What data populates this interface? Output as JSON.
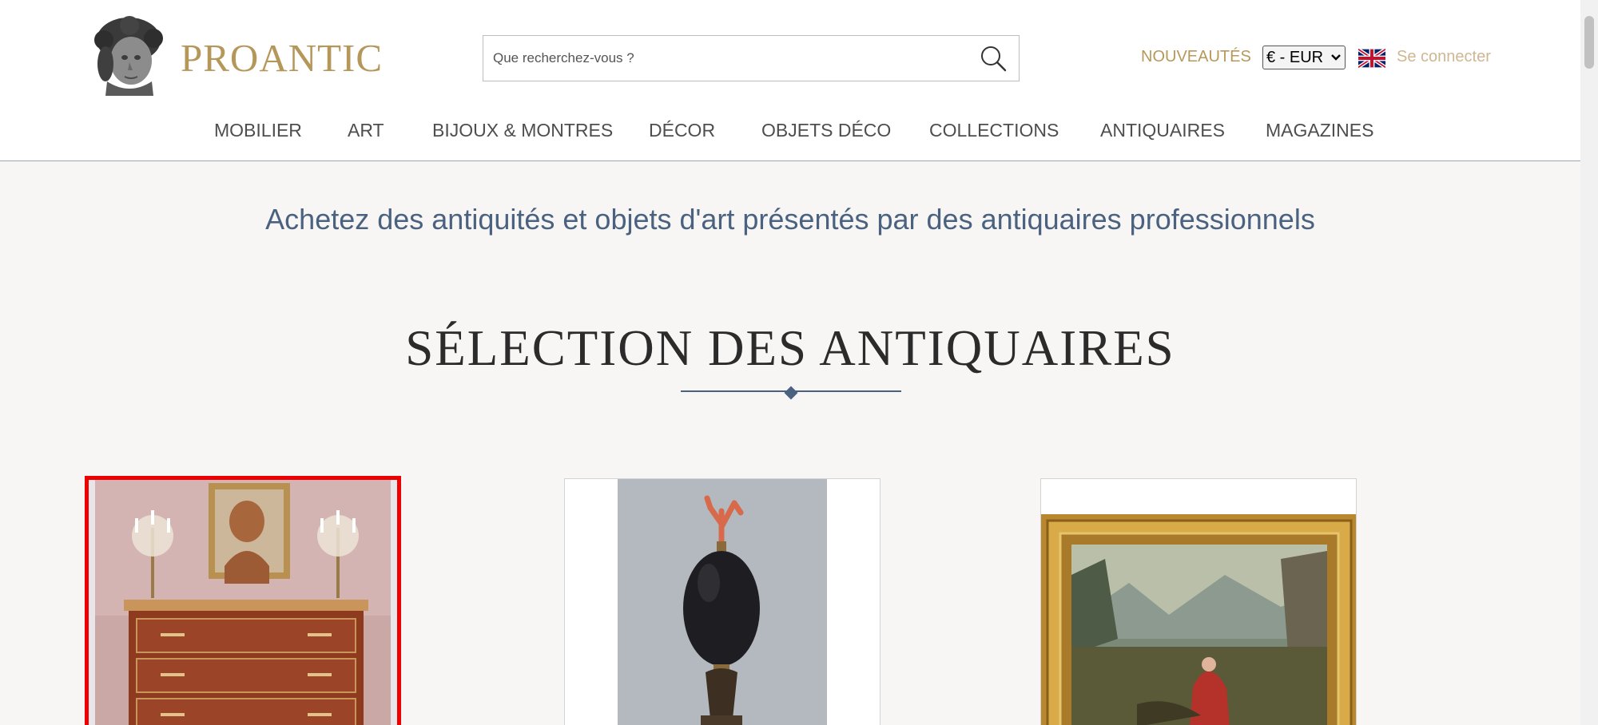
{
  "header": {
    "logo_text": "PROANTIC",
    "search_placeholder": "Que recherchez-vous ?",
    "nouveautes": "NOUVEAUTÉS",
    "currency": "€ - EUR",
    "login": "Se connecter"
  },
  "nav": [
    "MOBILIER",
    "ART",
    "BIJOUX & MONTRES",
    "DÉCOR",
    "OBJETS DÉCO",
    "COLLECTIONS",
    "ANTIQUAIRES",
    "MAGAZINES"
  ],
  "tagline": "Achetez des antiquités et objets d'art présentés par des antiquaires professionnels",
  "section_title": "SÉLECTION DES ANTIQUAIRES",
  "colors": {
    "brand_gold": "#b6975a",
    "nav_text": "#4e4e4e",
    "accent_blue": "#4a6280",
    "selection_red": "#ee0000"
  }
}
